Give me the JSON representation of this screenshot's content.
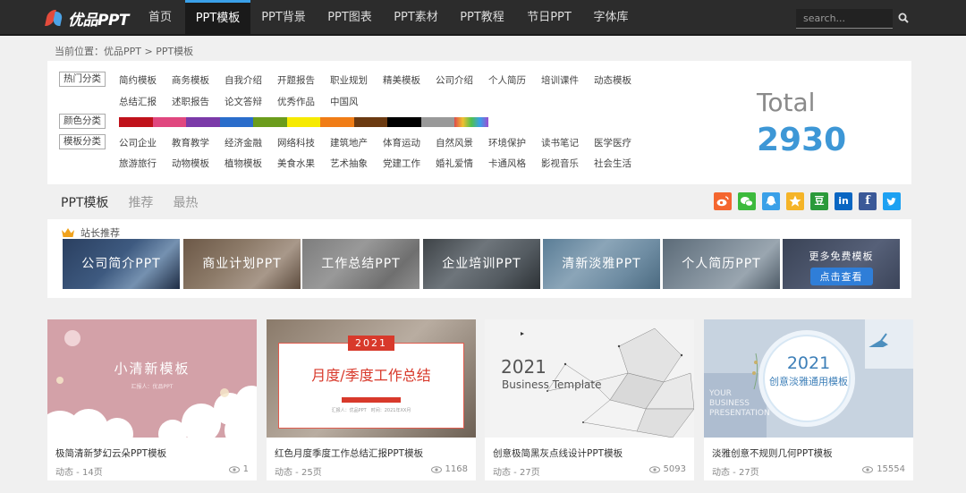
{
  "nav": {
    "logo_text": "优品PPT",
    "items": [
      "首页",
      "PPT模板",
      "PPT背景",
      "PPT图表",
      "PPT素材",
      "PPT教程",
      "节日PPT",
      "字体库"
    ],
    "active_index": 1,
    "search_placeholder": "search..."
  },
  "breadcrumb": "当前位置：优品PPT > PPT模板",
  "filters": {
    "hot_label": "热门分类",
    "hot_row1": [
      "简约模板",
      "商务模板",
      "自我介绍",
      "开题报告",
      "职业规划",
      "精美模板",
      "公司介绍",
      "个人简历",
      "培训课件",
      "动态模板"
    ],
    "hot_row2": [
      "总结汇报",
      "述职报告",
      "论文答辩",
      "优秀作品",
      "中国风"
    ],
    "color_label": "颜色分类",
    "colors": [
      "#c0121b",
      "#e0477f",
      "#7b3aa8",
      "#2a6dcb",
      "#6b9c1c",
      "#f6ea00",
      "#f07d16",
      "#6b3a11",
      "#000000",
      "#999999",
      "rainbow"
    ],
    "template_label": "模板分类",
    "tpl_row1": [
      "公司企业",
      "教育教学",
      "经济金融",
      "网络科技",
      "建筑地产",
      "体育运动",
      "自然风景",
      "环境保护",
      "读书笔记",
      "医学医疗"
    ],
    "tpl_row2": [
      "旅游旅行",
      "动物模板",
      "植物模板",
      "美食水果",
      "艺术抽象",
      "党建工作",
      "婚礼爱情",
      "卡通风格",
      "影视音乐",
      "社会生活"
    ]
  },
  "total": {
    "label": "Total",
    "value": "2930"
  },
  "tabs": [
    "PPT模板",
    "推荐",
    "最热"
  ],
  "social": [
    "weibo-icon",
    "wechat-icon",
    "qq-icon",
    "qzone-icon",
    "douban-icon",
    "linkedin-icon",
    "facebook-icon",
    "twitter-icon"
  ],
  "social_glyphs": {
    "douban": "豆",
    "linkedin": "in",
    "facebook": "f"
  },
  "recommend": {
    "title": "站长推荐",
    "banners": [
      "公司简介PPT",
      "商业计划PPT",
      "工作总结PPT",
      "企业培训PPT",
      "清新淡雅PPT",
      "个人简历PPT"
    ],
    "more_text": "更多免费模板",
    "more_button": "点击查看"
  },
  "cards": [
    {
      "title": "极简清新梦幻云朵PPT模板",
      "meta": "动态 - 14页",
      "views": "1",
      "thumb_title": "小清新模板",
      "thumb_sub": "汇报人：优品PPT"
    },
    {
      "title": "红色月度季度工作总结汇报PPT模板",
      "meta": "动态 - 25页",
      "views": "1168",
      "thumb_year": "2021",
      "thumb_title": "月度/季度工作总结",
      "thumb_sub": "汇报人：优品PPT　时间：2021年XX月"
    },
    {
      "title": "创意极简黑灰点线设计PPT模板",
      "meta": "动态 - 27页",
      "views": "5093",
      "thumb_year": "2021",
      "thumb_title": "Business Template"
    },
    {
      "title": "淡雅创意不规则几何PPT模板",
      "meta": "动态 - 27页",
      "views": "15554",
      "thumb_year": "2021",
      "thumb_title": "创意淡雅通用模板",
      "thumb_bg": "YOUR BUSINESS PRESENTATION"
    }
  ]
}
